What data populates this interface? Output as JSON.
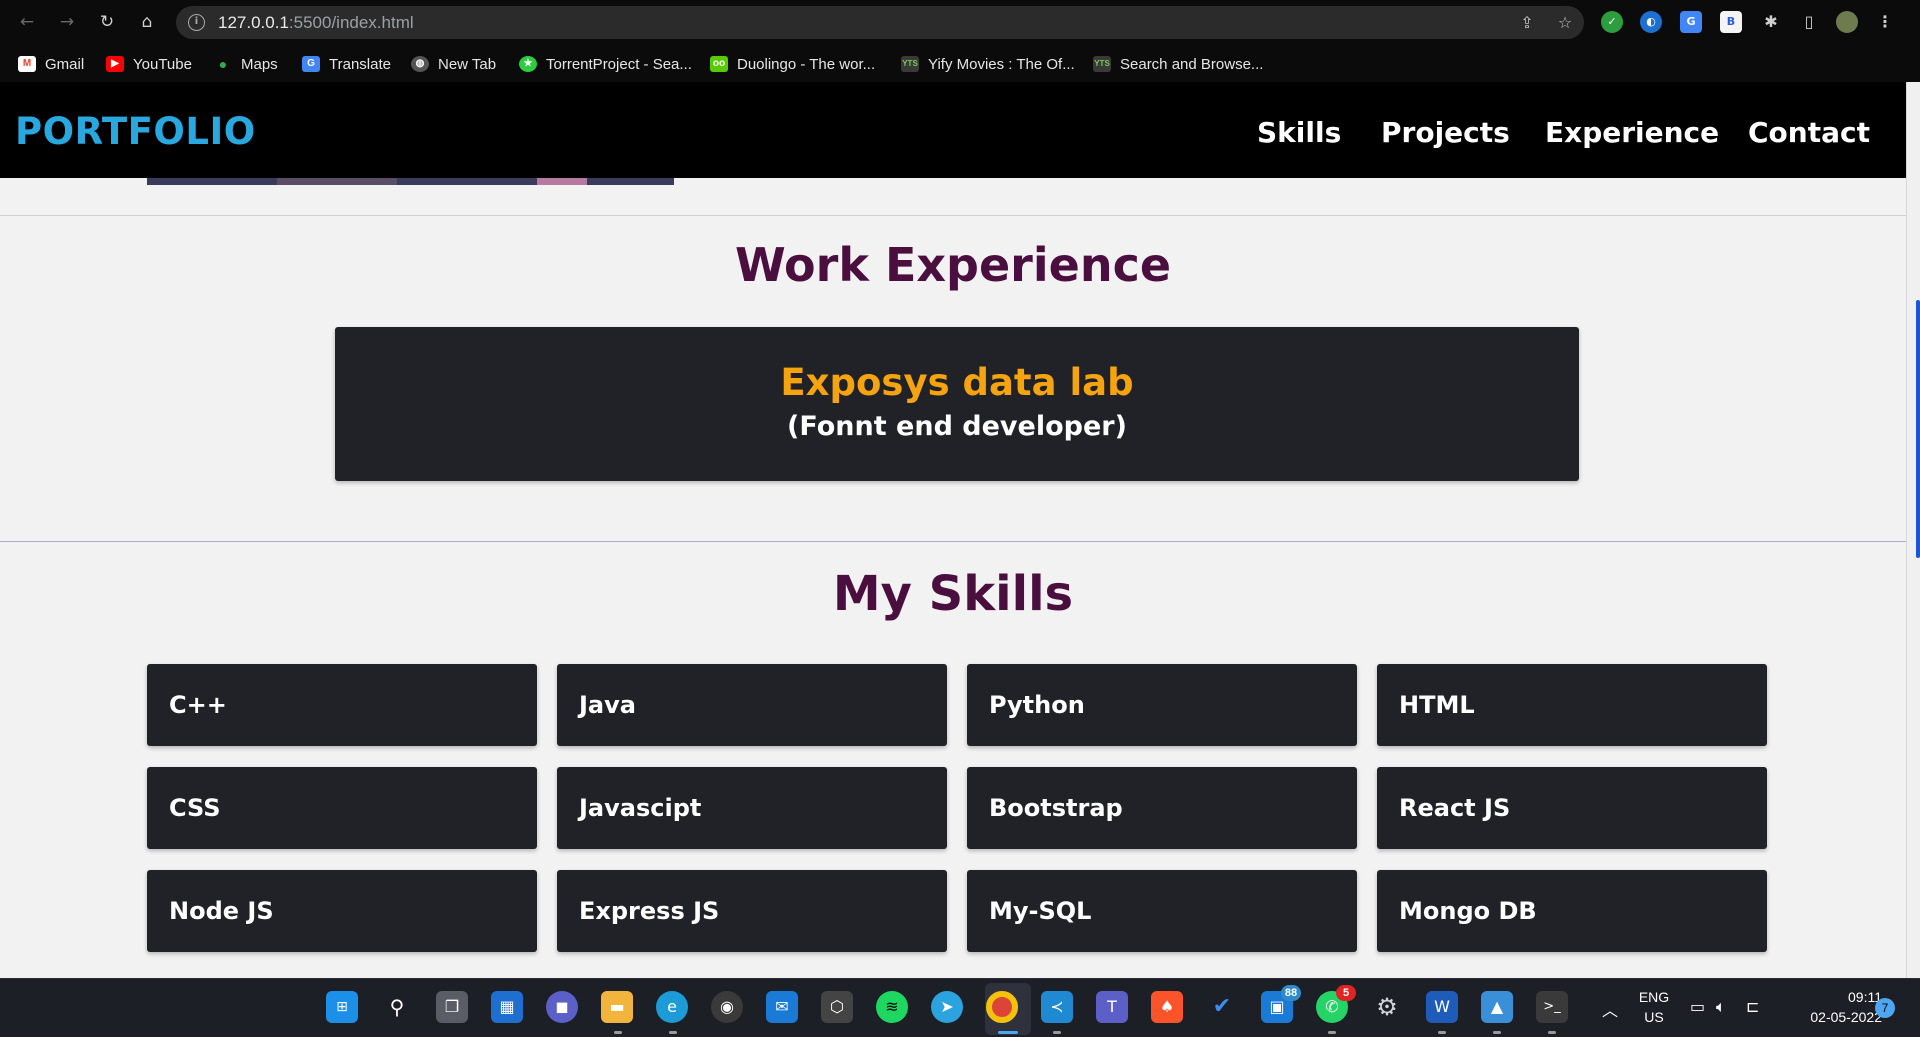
{
  "browser": {
    "url_host": "127.0.0.1",
    "url_path": ":5500/index.html",
    "bookmarks": [
      {
        "label": "Gmail",
        "icon": "gmail-icon",
        "color": "#ea4335"
      },
      {
        "label": "YouTube",
        "icon": "youtube-icon",
        "color": "#ff0000"
      },
      {
        "label": "Maps",
        "icon": "maps-icon",
        "color": "#34a853"
      },
      {
        "label": "Translate",
        "icon": "translate-icon",
        "color": "#4285f4"
      },
      {
        "label": "New Tab",
        "icon": "globe-icon",
        "color": "#777777"
      },
      {
        "label": "TorrentProject - Sea...",
        "icon": "torrentproject-icon",
        "color": "#2ecc40"
      },
      {
        "label": "Duolingo - The wor...",
        "icon": "duolingo-icon",
        "color": "#58cc02"
      },
      {
        "label": "Yify Movies : The Of...",
        "icon": "yify-icon",
        "color": "#3a3a3a"
      },
      {
        "label": "Search and Browse...",
        "icon": "yify-icon",
        "color": "#3a3a3a"
      }
    ]
  },
  "site": {
    "brand": "PORTFOLIO",
    "nav": [
      "Skills",
      "Projects",
      "Experience",
      "Contact"
    ],
    "work_title": "Work Experience",
    "experience": {
      "company": "Exposys data lab",
      "role": "(Fonnt end developer)"
    },
    "skills_title": "My Skills",
    "skills": [
      "C++",
      "Java",
      "Python",
      "HTML",
      "CSS",
      "Javascipt",
      "Bootstrap",
      "React JS",
      "Node JS",
      "Express JS",
      "My-SQL",
      "Mongo DB"
    ]
  },
  "colors": {
    "brand": "#29a8e0",
    "section_title": "#4a0f3e",
    "company": "#f5a30f",
    "card_bg": "#202227"
  },
  "taskbar": {
    "apps": [
      "windows-start-icon",
      "search-icon",
      "task-view-icon",
      "widgets-icon",
      "teams-chat-icon",
      "file-explorer-icon",
      "edge-icon",
      "obs-icon",
      "mail-icon",
      "unity-icon",
      "spotify-icon",
      "telegram-icon",
      "chrome-icon",
      "vscode-icon",
      "teams-icon",
      "brave-icon",
      "todo-icon",
      "store-icon",
      "whatsapp-icon",
      "settings-icon",
      "word-icon",
      "photos-icon",
      "terminal-icon"
    ],
    "badges": {
      "store": "88",
      "whatsapp": "5"
    },
    "lang": "ENG",
    "region": "US",
    "time": "09:11",
    "date": "02-05-2022",
    "notifications": "7"
  }
}
